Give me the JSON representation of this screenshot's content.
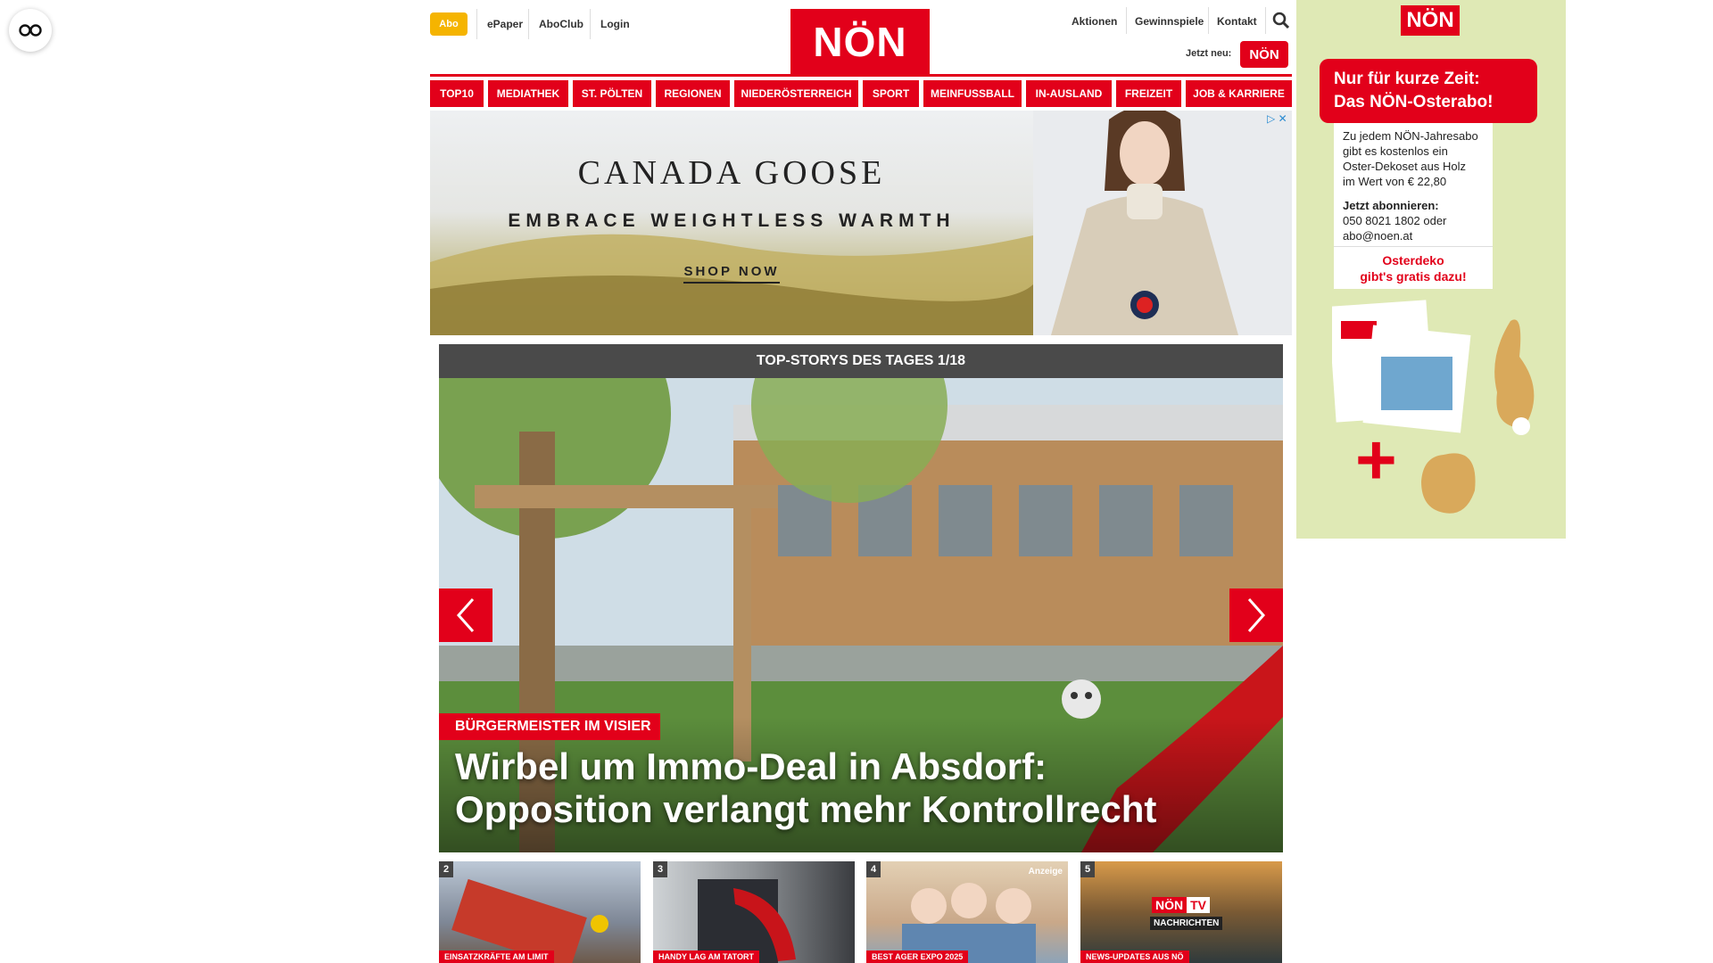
{
  "accessibility": {
    "icon": "accessibility-icon"
  },
  "header": {
    "abo_label": "Abo",
    "left_links": [
      "ePaper",
      "AboClub",
      "Login"
    ],
    "logo_text": "NÖN",
    "right_links": [
      "Aktionen",
      "Gewinnspiele",
      "Kontakt"
    ],
    "search_icon": "search-icon",
    "jetzt_neu_label": "Jetzt neu:",
    "jetzt_neu_logo": "NÖN"
  },
  "nav": {
    "items": [
      "TOP10",
      "MEDIATHEK",
      "ST. PÖLTEN",
      "REGIONEN",
      "NIEDERÖSTERREICH",
      "SPORT",
      "MEINFUSSBALL",
      "IN-AUSLAND",
      "FREIZEIT",
      "JOB & KARRIERE"
    ]
  },
  "ad": {
    "brand": "CANADA GOOSE",
    "slogan": "EMBRACE WEIGHTLESS WARMTH",
    "cta": "SHOP NOW"
  },
  "topstories": {
    "header": "TOP-STORYS DES TAGES 1/18",
    "kicker": "BÜRGERMEISTER IM VISIER",
    "headline_line1": "Wirbel um Immo-Deal in Absdorf:",
    "headline_line2": "Opposition verlangt mehr Kontrollrecht",
    "prev_icon": "chevron-left-icon",
    "next_icon": "chevron-right-icon"
  },
  "thumbs": [
    {
      "num": "2",
      "label": "EINSATZKRÄFTE AM LIMIT"
    },
    {
      "num": "3",
      "label": "HANDY LAG AM TATORT"
    },
    {
      "num": "4",
      "label": "BEST AGER EXPO 2025",
      "badge": "Anzeige"
    },
    {
      "num": "5",
      "label": "NEWS-UPDATES AUS NÖ",
      "logo": "NÖN",
      "logo_tv": "TV",
      "logo_sub": "NACHRICHTEN"
    }
  ],
  "sidead": {
    "logo": "NÖN",
    "title_line1": "Nur für kurze Zeit:",
    "title_line2": "Das NÖN-Osterabo!",
    "body1": "Zu jedem NÖN-Jahresabo",
    "body2": "gibt es kostenlos ein",
    "body3": "Oster-Dekoset aus Holz",
    "body4": "im Wert von € 22,80",
    "sub_title": "Jetzt abonnieren:",
    "sub_phone": "050 8021 1802 oder",
    "sub_mail": "abo@noen.at",
    "promo1": "Osterdeko",
    "promo2": "gibt's gratis dazu!",
    "plus": "+"
  }
}
